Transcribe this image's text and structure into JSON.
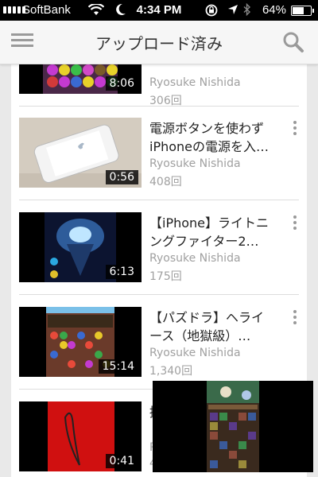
{
  "status": {
    "carrier": "SoftBank",
    "time": "4:34 PM",
    "battery": "64%",
    "battery_level": 0.64
  },
  "appbar": {
    "title": "アップロード済み"
  },
  "videos": [
    {
      "title": "",
      "duration": "8:06",
      "channel": "Ryosuke Nishida",
      "views": "306回"
    },
    {
      "title_line1": "電源ボタンを使わず",
      "title_line2": "iPhoneの電源を入…",
      "duration": "0:56",
      "channel": "Ryosuke Nishida",
      "views": "408回"
    },
    {
      "title_line1": "【iPhone】ライトニ",
      "title_line2": "ングファイター2…",
      "duration": "6:13",
      "channel": "Ryosuke Nishida",
      "views": "175回"
    },
    {
      "title_line1": "【パズドラ】ヘライ",
      "title_line2": "ース（地獄級）…",
      "duration": "15:14",
      "channel": "Ryosuke Nishida",
      "views": "1,340回"
    },
    {
      "title_line1": "掘",
      "duration": "0:41",
      "channel": "R",
      "views": "4"
    }
  ]
}
